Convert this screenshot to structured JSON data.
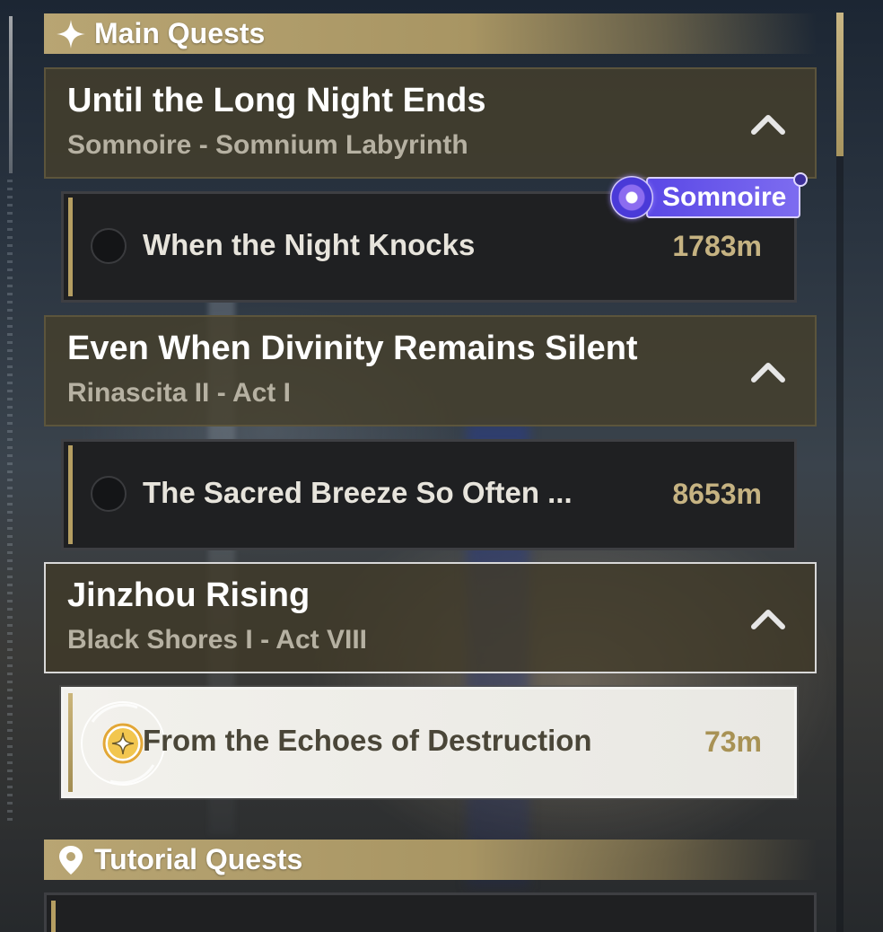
{
  "main_section": {
    "title": "Main Quests",
    "icon": "sparkle-icon"
  },
  "quests": [
    {
      "title": "Until the Long Night Ends",
      "subtitle": "Somnoire - Somnium Labyrinth",
      "expanded": true,
      "task": {
        "name": "When the Night Knocks",
        "distance": "1783m",
        "tracked": false
      },
      "badge": "Somnoire"
    },
    {
      "title": "Even When Divinity Remains Silent",
      "subtitle": "Rinascita II - Act I",
      "expanded": true,
      "task": {
        "name": "The Sacred Breeze So Often ...",
        "distance": "8653m",
        "tracked": false
      }
    },
    {
      "title": "Jinzhou Rising",
      "subtitle": "Black Shores I - Act VIII",
      "expanded": true,
      "task": {
        "name": "From the Echoes of Destruction",
        "distance": "73m",
        "tracked": true
      }
    }
  ],
  "tutorial_section": {
    "title": "Tutorial Quests",
    "icon": "map-pin-icon"
  },
  "colors": {
    "accent_gold": "#b8a573",
    "badge_purple": "#5a48e6",
    "distance_gold": "#c6b382"
  }
}
